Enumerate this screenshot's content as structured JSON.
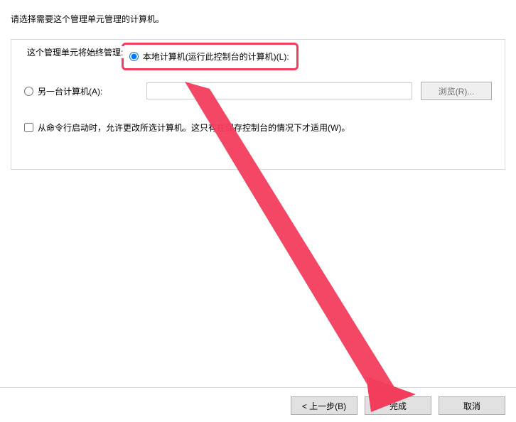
{
  "instruction": "请选择需要这个管理单元管理的计算机。",
  "group": {
    "label": "这个管理单元将始终管理:",
    "localComputer": {
      "label": "本地计算机(运行此控制台的计算机)(L):",
      "selected": true
    },
    "anotherComputer": {
      "label": "另一台计算机(A):",
      "selected": false,
      "inputValue": "",
      "browseLabel": "浏览(R)..."
    },
    "checkbox": {
      "label": "从命令行启动时，允许更改所选计算机。这只有在保存控制台的情况下才适用(W)。",
      "checked": false
    }
  },
  "footer": {
    "back": "< 上一步(B)",
    "finish": "完成",
    "cancel": "取消"
  },
  "annotation": {
    "highlightColor": "#f23d5d",
    "arrowColor": "#f23d5d"
  }
}
